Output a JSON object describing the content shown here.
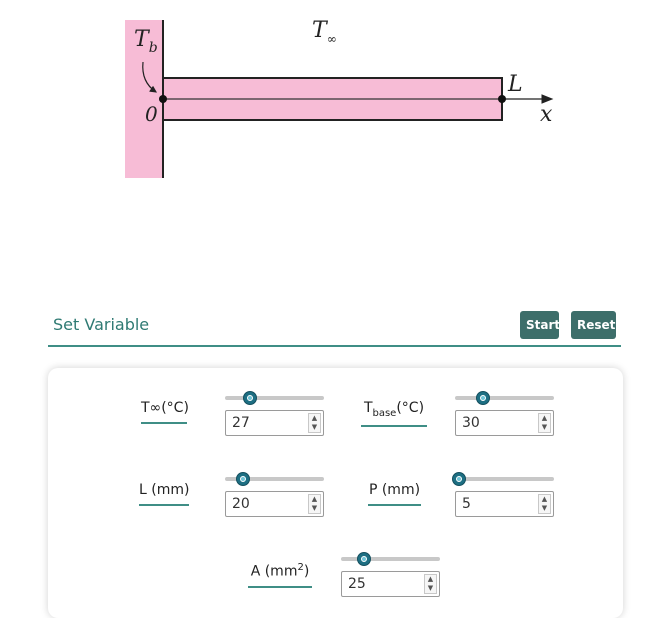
{
  "diagram": {
    "t_b_label": "T",
    "t_b_sub": "b",
    "t_inf_label": "T",
    "t_inf_sub": "∞",
    "origin_label": "0",
    "length_label": "L",
    "axis_label": "x",
    "colors": {
      "wall": "#f7bcd6",
      "fin": "#f7bcd6",
      "outline": "#222222"
    }
  },
  "header": {
    "title": "Set Variable",
    "start_label": "Start",
    "reset_label": "Reset",
    "accent": "#3f8e86",
    "button_color": "#3d6e6a"
  },
  "variables": {
    "t_inf": {
      "label": "T∞(°C)",
      "value": "27",
      "slider_fraction": 0.25
    },
    "t_base": {
      "label_main": "T",
      "label_sub": "base",
      "label_unit": "(°C)",
      "value": "30",
      "slider_fraction": 0.28
    },
    "length": {
      "label": "L (mm)",
      "value": "20",
      "slider_fraction": 0.18
    },
    "perimeter": {
      "label": "P (mm)",
      "value": "5",
      "slider_fraction": 0.04
    },
    "area": {
      "label_main": "A (mm",
      "label_sup": "2",
      "label_end": ")",
      "value": "25",
      "slider_fraction": 0.23
    }
  },
  "icons": {
    "spinner": "spinner-up-down-icon",
    "slider_thumb": "slider-thumb-icon"
  }
}
